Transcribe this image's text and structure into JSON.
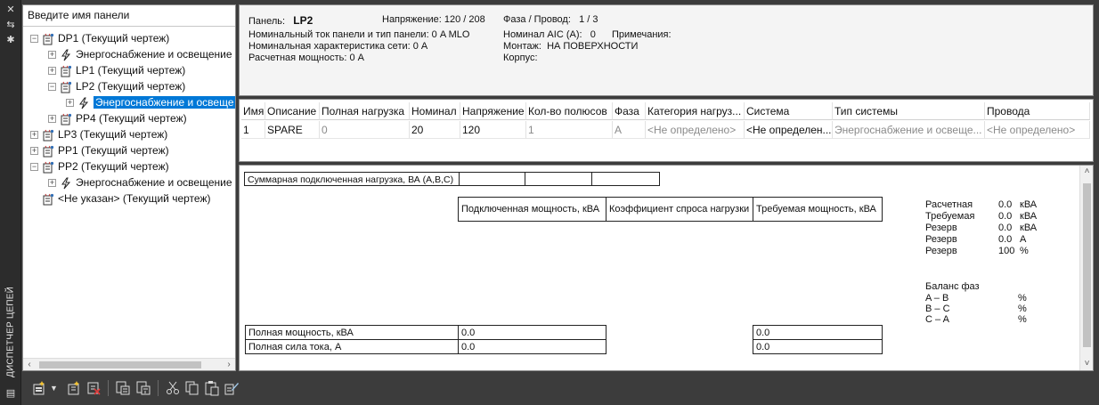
{
  "palette_title": "ДИСПЕТЧЕР ЦЕПЕЙ",
  "search": {
    "placeholder": "Введите имя панели"
  },
  "tree": [
    {
      "label": "DP1 (Текущий чертеж)",
      "level": 0,
      "expander": "−",
      "icon": "panel-icon"
    },
    {
      "label": "Энергоснабжение и освещение",
      "level": 1,
      "expander": "+",
      "icon": "circuit-icon"
    },
    {
      "label": "LP1 (Текущий чертеж)",
      "level": 1,
      "expander": "+",
      "icon": "panel-icon"
    },
    {
      "label": "LP2 (Текущий чертеж)",
      "level": 1,
      "expander": "−",
      "icon": "panel-icon"
    },
    {
      "label": "Энергоснабжение и освеще",
      "level": 2,
      "expander": "+",
      "icon": "circuit-icon",
      "selected": true
    },
    {
      "label": "PP4 (Текущий чертеж)",
      "level": 1,
      "expander": "+",
      "icon": "panel-icon"
    },
    {
      "label": "LP3 (Текущий чертеж)",
      "level": 0,
      "expander": "+",
      "icon": "panel-icon"
    },
    {
      "label": "PP1 (Текущий чертеж)",
      "level": 0,
      "expander": "+",
      "icon": "panel-icon"
    },
    {
      "label": "PP2 (Текущий чертеж)",
      "level": 0,
      "expander": "−",
      "icon": "panel-icon"
    },
    {
      "label": "Энергоснабжение и освещение",
      "level": 1,
      "expander": "+",
      "icon": "circuit-icon"
    },
    {
      "label": "<Не указан> (Текущий чертеж)",
      "level": 0,
      "expander": "",
      "icon": "panel-icon"
    }
  ],
  "panel_info": {
    "panel_label": "Панель:",
    "panel_value": "LP2",
    "voltage": "Напряжение: 120 / 208",
    "phase_wire_label": "Фаза / Провод:",
    "phase_wire_value": "1 / 3",
    "rating": "Номинальный ток панели и тип панели: 0 A MLO",
    "aic_label": "Номинал AIC (A):",
    "aic_value": "0",
    "notes_label": "Примечания:",
    "network_rating": "Номинальная характеристика сети: 0 A",
    "mounting_label": "Монтаж:",
    "mounting_value": "НА ПОВЕРХНОСТИ",
    "calc_power": "Расчетная мощность: 0 A",
    "enclosure_label": "Корпус:"
  },
  "circuit_grid": {
    "columns": [
      "Имя",
      "Описание",
      "Полная нагрузка",
      "Номинал",
      "Напряжение",
      "Кол-во полюсов",
      "Фаза",
      "Категория нагруз...",
      "Система",
      "Тип системы",
      "Провода"
    ],
    "rows": [
      [
        "1",
        "SPARE",
        "0",
        "20",
        "120",
        "1",
        "A",
        "<Не определено>",
        "<Не определен...",
        "Энергоснабжение и освеще...",
        "<Не определено>"
      ]
    ]
  },
  "summary": {
    "connected_load_label": "Суммарная подключенная нагрузка, ВА (A,B,C)",
    "headers": [
      "Подключенная мощность, кВА",
      "Коэффициент спроса нагрузки",
      "Требуемая мощность, кВА"
    ],
    "total_power_label": "Полная мощность, кВА",
    "total_power_value": "0.0",
    "total_power_demand": "0.0",
    "total_current_label": "Полная сила тока, A",
    "total_current_value": "0.0",
    "total_current_demand": "0.0"
  },
  "stats": [
    {
      "label": "Расчетная",
      "value": "0.0",
      "unit": "кВА"
    },
    {
      "label": "Требуемая",
      "value": "0.0",
      "unit": "кВА"
    },
    {
      "label": "Резерв",
      "value": "0.0",
      "unit": "кВА"
    },
    {
      "label": "Резерв",
      "value": "0.0",
      "unit": "A"
    },
    {
      "label": "Резерв",
      "value": "100",
      "unit": "%"
    }
  ],
  "phase_balance": {
    "title": "Баланс фаз",
    "rows": [
      {
        "label": "A – B",
        "unit": "%"
      },
      {
        "label": "B – C",
        "unit": "%"
      },
      {
        "label": "C – A",
        "unit": "%"
      }
    ]
  },
  "colors": {
    "selection": "#0078d7",
    "panel_bg": "#3c3c3c",
    "pane_border": "#8c8c8c"
  }
}
